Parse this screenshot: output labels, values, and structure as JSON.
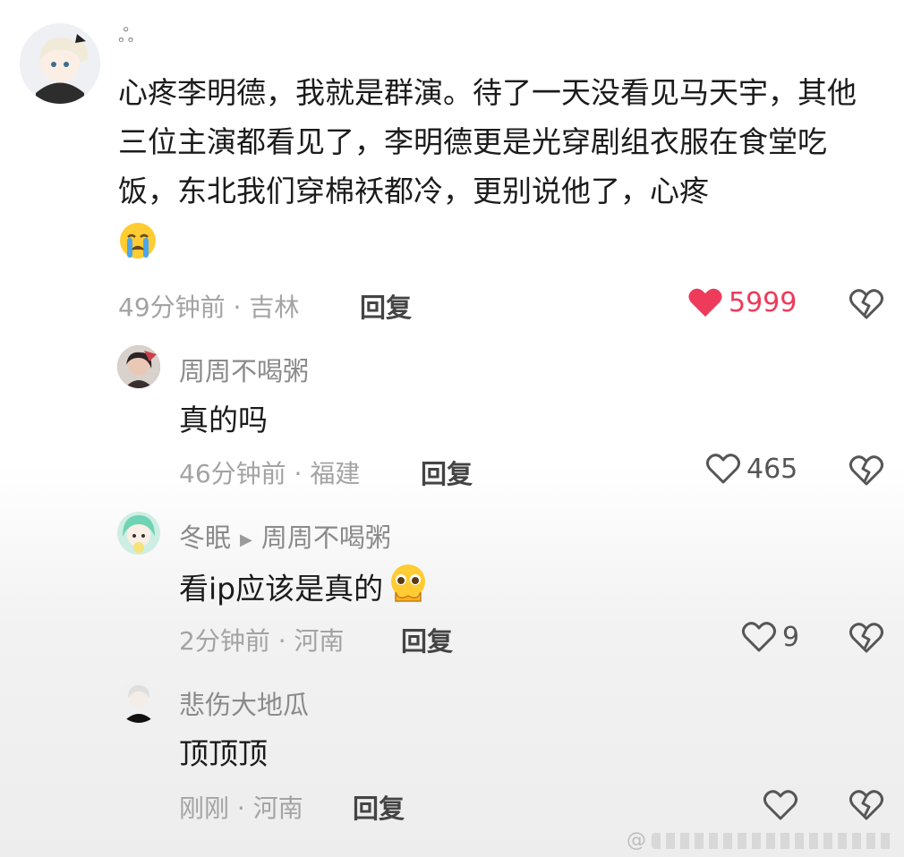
{
  "comments": [
    {
      "username": "ஃ",
      "text": "心疼李明德，我就是群演。待了一天没看见马天宇，其他三位主演都看见了，李明德更是光穿剧组衣服在食堂吃饭，东北我们穿棉袄都冷，更别说他了，心疼",
      "emoji": "crying-face-emoji",
      "meta": "49分钟前 · 吉林",
      "reply_label": "回复",
      "likes": "5999",
      "liked": true
    },
    {
      "username": "周周不喝粥",
      "text": "真的吗",
      "meta": "46分钟前 · 福建",
      "reply_label": "回复",
      "likes": "465",
      "liked": false
    },
    {
      "username": "冬眠",
      "reply_to": "周周不喝粥",
      "text": "看ip应该是真的",
      "emoji": "pleading-face-emoji",
      "meta": "2分钟前 · 河南",
      "reply_label": "回复",
      "likes": "9",
      "liked": false
    },
    {
      "username": "悲伤大地瓜",
      "text": "顶顶顶",
      "meta": "刚刚 · 河南",
      "reply_label": "回复",
      "likes": "",
      "liked": false
    }
  ],
  "colors": {
    "like_active": "#ee3b5b",
    "meta_gray": "#a3a3a3",
    "name_gray": "#8a8a8a"
  },
  "icons": [
    "heart-icon",
    "broken-heart-icon"
  ],
  "watermark_glyph": "@"
}
